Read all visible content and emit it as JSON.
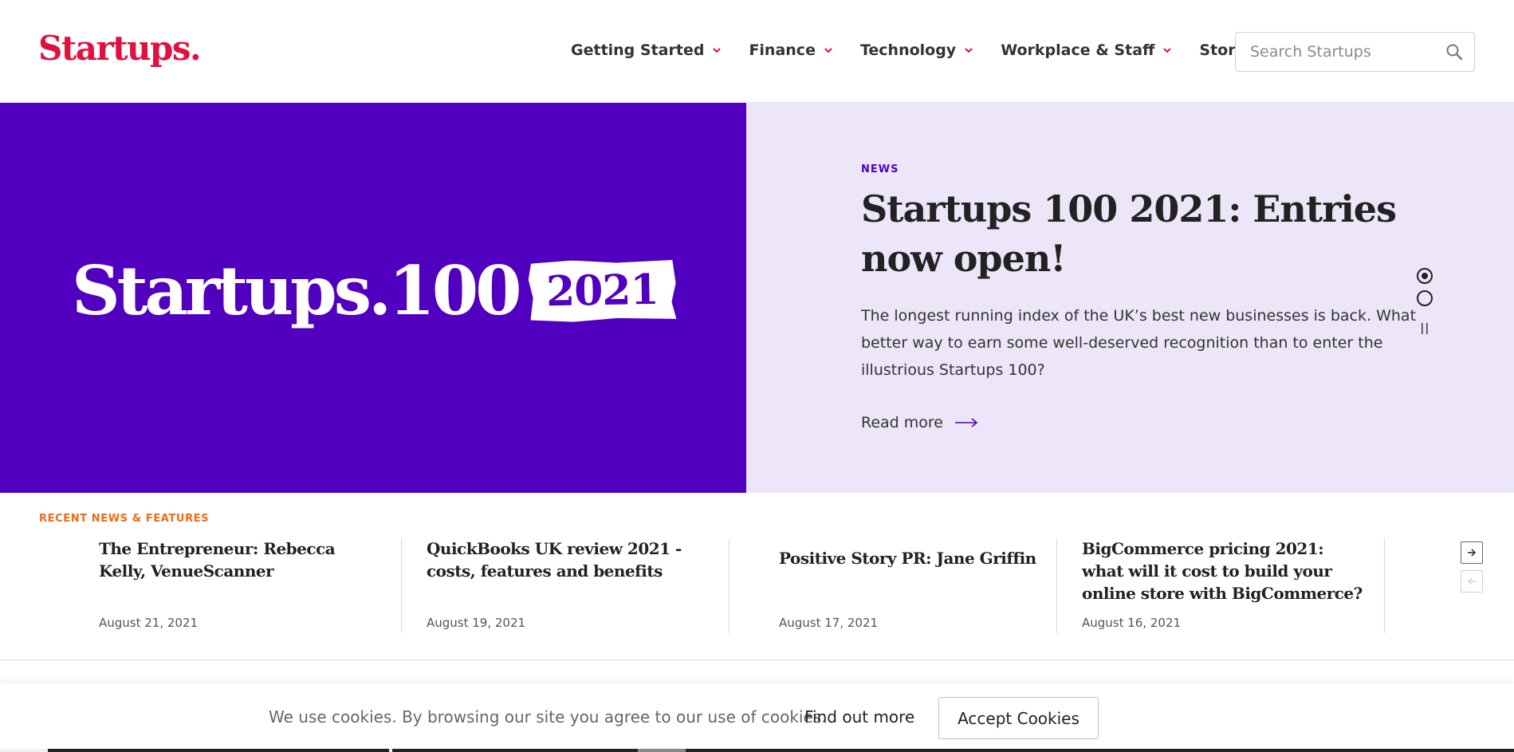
{
  "header": {
    "logo": "Startups.",
    "nav": [
      {
        "label": "Getting Started"
      },
      {
        "label": "Finance"
      },
      {
        "label": "Technology"
      },
      {
        "label": "Workplace & Staff"
      },
      {
        "label": "Stories"
      }
    ],
    "search_placeholder": "Search Startups",
    "search_icon": "magnifier-icon"
  },
  "hero": {
    "image_text": "Startups.100",
    "image_year": "2021",
    "tag": "NEWS",
    "title": "Startups 100 2021: Entries now open!",
    "description": "The longest running index of the UK’s best new businesses is back. What better way to earn some well-deserved recognition than to enter the illustrious Startups 100?",
    "read_more": "Read more",
    "slide_count": 2,
    "active_slide": 1
  },
  "recent": {
    "label": "RECENT NEWS & FEATURES",
    "items": [
      {
        "title": "The Entrepreneur: Rebecca Kelly, VenueScanner",
        "date": "August 21, 2021"
      },
      {
        "title": "QuickBooks UK review 2021 - costs, features and benefits",
        "date": "August 19, 2021"
      },
      {
        "title": "Positive Story PR: Jane Griffin",
        "date": "August 17, 2021"
      },
      {
        "title": "BigCommerce pricing 2021: what will it cost to build your online store with BigCommerce?",
        "date": "August 16, 2021"
      }
    ]
  },
  "cookie": {
    "text": "We use cookies. By browsing our site you agree to our use of cookies.",
    "link": "Find out more",
    "button": "Accept Cookies"
  },
  "colors": {
    "brand_red": "#e0103f",
    "hero_purple": "#5200c0",
    "hero_lavender": "#ece6f8",
    "accent_orange": "#f26a10"
  }
}
